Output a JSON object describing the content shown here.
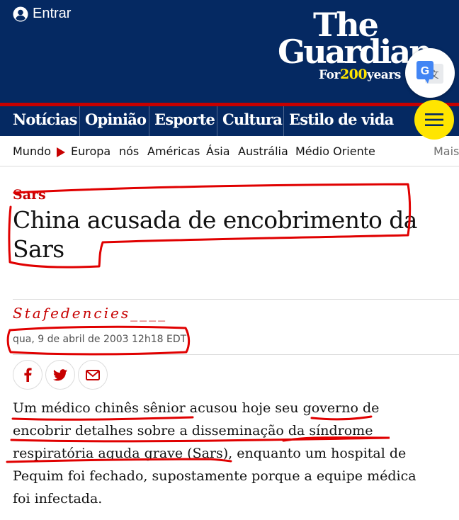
{
  "header": {
    "signin_label": "Entrar",
    "logo_the": "The",
    "logo_guardian": "Guardian",
    "logo_for": "For",
    "logo_num": "200",
    "logo_years": "years"
  },
  "pillars": [
    "Notícias",
    "Opinião",
    "Esporte",
    "Cultura",
    "Estilo de vida"
  ],
  "subnav": {
    "items": [
      "Mundo",
      "Europa",
      "nós",
      "Américas",
      "Ásia",
      "Austrália",
      "Médio Oriente"
    ],
    "more": "Mais"
  },
  "article": {
    "kicker": "Sars",
    "headline": "China acusada de encobrimento da Sars",
    "byline": "Stafedencies____",
    "dateline": "qua, 9 de abril de 2003 12h18 EDT",
    "body": "Um médico chinês sênior acusou hoje seu governo de encobrir detalhes sobre a disseminação da síndrome respiratória aguda grave (Sars), enquanto um hospital de Pequim foi fechado, supostamente porque a equipe médica foi infectada."
  },
  "share_icons": [
    "facebook-icon",
    "twitter-icon",
    "email-icon"
  ],
  "colors": {
    "brand_navy": "#052962",
    "accent_red": "#c70000",
    "menu_yellow": "#ffe500",
    "annotation_red": "#e00000"
  }
}
